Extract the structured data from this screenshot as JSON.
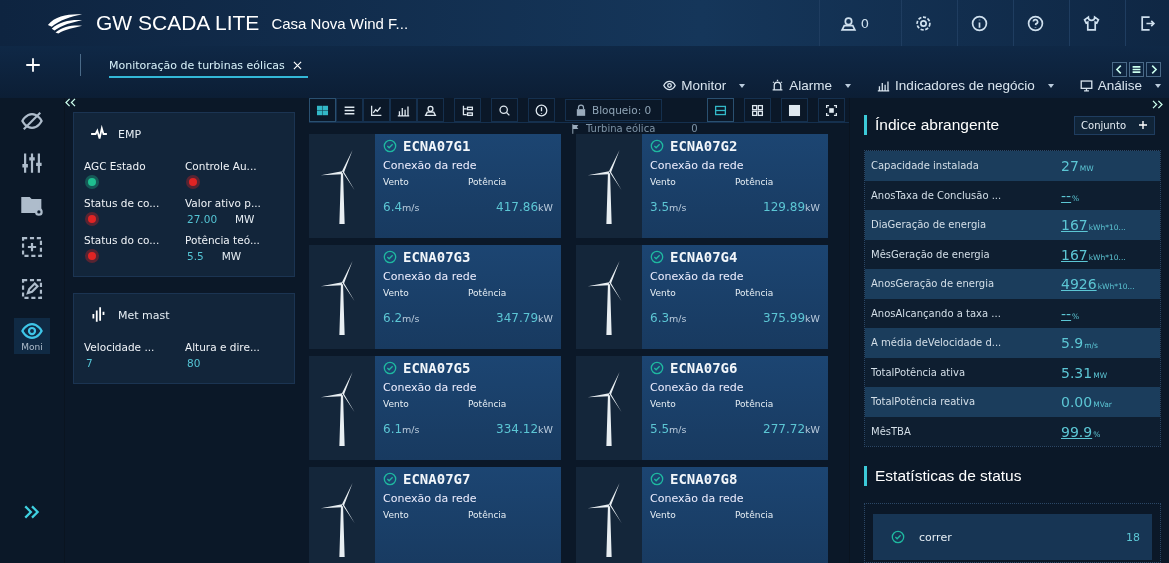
{
  "header": {
    "title": "GW SCADA LITE",
    "site": "Casa Nova Wind F...",
    "user_count": "0",
    "actions": [
      {
        "kind": "settings"
      },
      {
        "kind": "info"
      },
      {
        "kind": "help"
      },
      {
        "kind": "shirt"
      },
      {
        "kind": "logout"
      }
    ]
  },
  "tabs": [
    {
      "label": "Monitoração de turbinas eólicas",
      "selected": true
    }
  ],
  "menus": [
    {
      "label": "Monitor",
      "kind": "eye"
    },
    {
      "label": "Alarme",
      "kind": "alarm"
    },
    {
      "label": "Indicadores de negócio",
      "kind": "bars"
    },
    {
      "label": "Análise",
      "kind": "screen"
    }
  ],
  "rail": [
    {
      "kind": "hide",
      "selected": false
    },
    {
      "kind": "sliders",
      "selected": false
    },
    {
      "kind": "folder",
      "selected": false
    },
    {
      "kind": "add",
      "selected": false
    },
    {
      "kind": "edit",
      "selected": false
    },
    {
      "kind": "eye",
      "label": "Moni",
      "selected": true
    }
  ],
  "cards": [
    {
      "title": "EMP",
      "kind": "wave",
      "fields": [
        {
          "label": "AGC Estado",
          "kind": "dot",
          "color": "#1fbf8f"
        },
        {
          "label": "Controle Au...",
          "kind": "dot",
          "color": "#e02424"
        },
        {
          "label": "Status de co...",
          "kind": "dot",
          "color": "#e02424"
        },
        {
          "label": "Valor ativo p...",
          "kind": "value",
          "value": "27.00",
          "unit": "MW"
        },
        {
          "label": "Status do co...",
          "kind": "dot",
          "color": "#e02424"
        },
        {
          "label": "Potência teó...",
          "kind": "value",
          "value": "5.5",
          "unit": "MW"
        }
      ]
    },
    {
      "title": "Met mast",
      "kind": "mast",
      "fields": [
        {
          "label": "Velocidade ...",
          "kind": "value",
          "value": "7"
        },
        {
          "label": "Altura e dire...",
          "kind": "value",
          "value": "80"
        }
      ]
    }
  ],
  "toolbar": {
    "views": [
      {
        "kind": "grid",
        "selected": true
      },
      {
        "kind": "list",
        "selected": false
      },
      {
        "kind": "line",
        "selected": false
      },
      {
        "kind": "bars",
        "selected": false
      },
      {
        "kind": "user",
        "selected": false
      }
    ],
    "tools": [
      {
        "kind": "tree"
      },
      {
        "kind": "search"
      },
      {
        "kind": "alert"
      }
    ],
    "lock": "Bloqueio: 0",
    "layouts": [
      {
        "kind": "rows",
        "selected": true
      },
      {
        "kind": "quad",
        "selected": false
      },
      {
        "kind": "table",
        "selected": false
      },
      {
        "kind": "fullscreen",
        "selected": false
      }
    ]
  },
  "group": {
    "label": "Turbina eólica",
    "count": "0"
  },
  "turbines": [
    {
      "name": "ECNA07G1",
      "status": "Conexão da rede",
      "wind_label": "Vento",
      "power_label": "Potência",
      "wind": "6.4",
      "wind_unit": "m/s",
      "power": "417.86",
      "power_unit": "kW"
    },
    {
      "name": "ECNA07G2",
      "status": "Conexão da rede",
      "wind_label": "Vento",
      "power_label": "Potência",
      "wind": "3.5",
      "wind_unit": "m/s",
      "power": "129.89",
      "power_unit": "kW"
    },
    {
      "name": "ECNA07G3",
      "status": "Conexão da rede",
      "wind_label": "Vento",
      "power_label": "Potência",
      "wind": "6.2",
      "wind_unit": "m/s",
      "power": "347.79",
      "power_unit": "kW"
    },
    {
      "name": "ECNA07G4",
      "status": "Conexão da rede",
      "wind_label": "Vento",
      "power_label": "Potência",
      "wind": "6.3",
      "wind_unit": "m/s",
      "power": "375.99",
      "power_unit": "kW"
    },
    {
      "name": "ECNA07G5",
      "status": "Conexão da rede",
      "wind_label": "Vento",
      "power_label": "Potência",
      "wind": "6.1",
      "wind_unit": "m/s",
      "power": "334.12",
      "power_unit": "kW"
    },
    {
      "name": "ECNA07G6",
      "status": "Conexão da rede",
      "wind_label": "Vento",
      "power_label": "Potência",
      "wind": "5.5",
      "wind_unit": "m/s",
      "power": "277.72",
      "power_unit": "kW"
    },
    {
      "name": "ECNA07G7",
      "status": "Conexão da rede",
      "wind_label": "Vento",
      "power_label": "Potência"
    },
    {
      "name": "ECNA07G8",
      "status": "Conexão da rede",
      "wind_label": "Vento",
      "power_label": "Potência"
    }
  ],
  "index": {
    "title": "Índice abrangente",
    "button": "Conjunto",
    "rows": [
      {
        "label": "Capacidade instalada",
        "value": "27",
        "unit": "MW",
        "link": false
      },
      {
        "label": "AnosTaxa de Conclusão ...",
        "value": "--",
        "unit": "%",
        "link": true
      },
      {
        "label": "DiaGeração de energia",
        "value": "167",
        "unit": "kWh*10...",
        "link": true
      },
      {
        "label": "MêsGeração de energia",
        "value": "167",
        "unit": "kWh*10...",
        "link": true
      },
      {
        "label": "AnosGeração de energia",
        "value": "4926",
        "unit": "kWh*10...",
        "link": true
      },
      {
        "label": "AnosAlcançando a taxa ...",
        "value": "--",
        "unit": "%",
        "link": true
      },
      {
        "label": "A média deVelocidade d...",
        "value": "5.9",
        "unit": "m/s",
        "link": false
      },
      {
        "label": "TotalPotência ativa",
        "value": "5.31",
        "unit": "MW",
        "link": false
      },
      {
        "label": "TotalPotência reativa",
        "value": "0.00",
        "unit": "MVar",
        "link": false
      },
      {
        "label": "MêsTBA",
        "value": "99.9",
        "unit": "%",
        "link": true
      }
    ]
  },
  "stats": {
    "title": "Estatísticas de status",
    "items": [
      {
        "label": "correr",
        "count": "18"
      }
    ]
  }
}
